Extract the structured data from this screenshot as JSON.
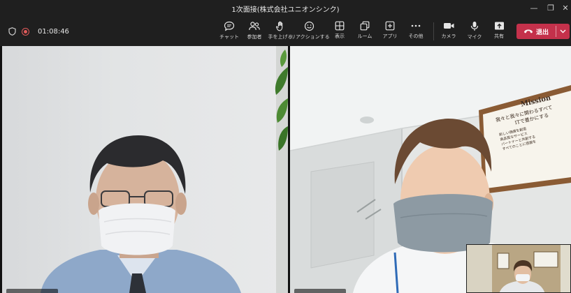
{
  "window": {
    "title": "1次面接(株式会社ユニオンシンク)",
    "minimize_glyph": "—",
    "restore_glyph": "❐",
    "close_glyph": "✕"
  },
  "toolbar": {
    "timer": "01:08:46",
    "items": [
      {
        "label": "チャット",
        "icon": "chat-icon"
      },
      {
        "label": "参加者",
        "icon": "participants-icon"
      },
      {
        "label": "手を上げる",
        "icon": "raise-hand-icon"
      },
      {
        "label": "リアクションする",
        "icon": "reaction-icon"
      },
      {
        "label": "表示",
        "icon": "view-icon"
      },
      {
        "label": "ルーム",
        "icon": "rooms-icon"
      },
      {
        "label": "アプリ",
        "icon": "apps-icon"
      },
      {
        "label": "その他",
        "icon": "more-icon"
      },
      {
        "label": "カメラ",
        "icon": "camera-icon"
      },
      {
        "label": "マイク",
        "icon": "mic-icon"
      },
      {
        "label": "共有",
        "icon": "share-icon"
      }
    ],
    "leave_label": "退出",
    "accent_color": "#c4314b"
  },
  "mission_board": {
    "title": "Mission",
    "line1": "我々と我々に関わるすべて",
    "line2": "ITで豊かにする",
    "bullets": [
      "新しい価値を創造",
      "高品質なサービス",
      "パートナーと共創する",
      "すべてのことに感謝を"
    ]
  }
}
